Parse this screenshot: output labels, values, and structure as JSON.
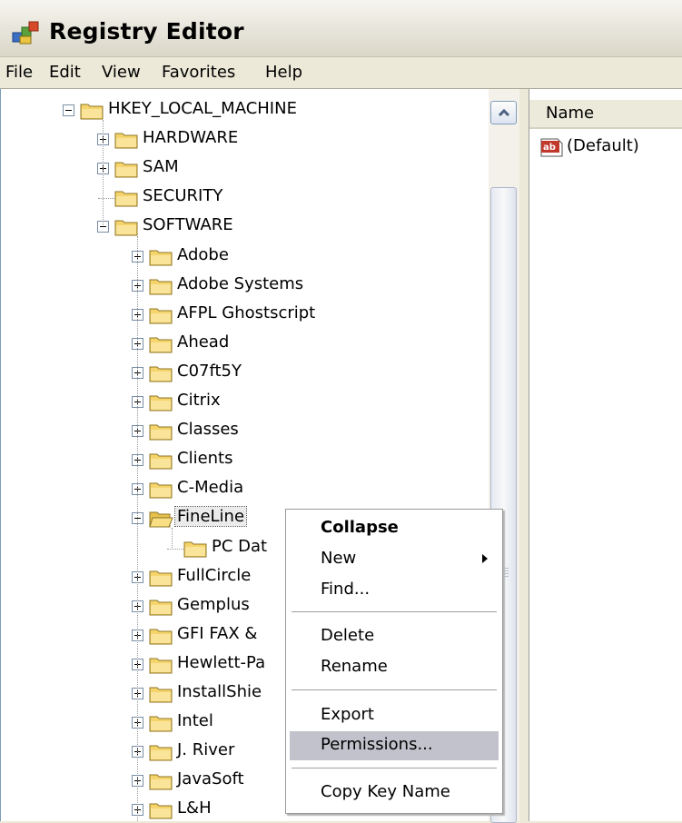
{
  "window": {
    "title": "Registry Editor"
  },
  "menu": [
    "File",
    "Edit",
    "View",
    "Favorites",
    "Help"
  ],
  "tree": {
    "root": "HKEY_LOCAL_MACHINE",
    "level1": [
      "HARDWARE",
      "SAM",
      "SECURITY",
      "SOFTWARE"
    ],
    "software_children": [
      "Adobe",
      "Adobe Systems",
      "AFPL Ghostscript",
      "Ahead",
      "C07ft5Y",
      "Citrix",
      "Classes",
      "Clients",
      "C-Media",
      "FineLine"
    ],
    "fineline_children": [
      "PC Dat"
    ],
    "software_children_after": [
      "FullCircle",
      "Gemplus",
      "GFI FAX &",
      "Hewlett-Pa",
      "InstallShie",
      "Intel",
      "J. River",
      "JavaSoft",
      "L&H"
    ]
  },
  "list": {
    "column_name": "Name",
    "rows": [
      "(Default)"
    ]
  },
  "context_menu": {
    "collapse": "Collapse",
    "new": "New",
    "find": "Find...",
    "delete": "Delete",
    "rename": "Rename",
    "export": "Export",
    "permissions": "Permissions...",
    "copy_key_name": "Copy Key Name"
  },
  "colors": {
    "highlight": "#c2c2cc",
    "folder": "#f5d46b"
  }
}
